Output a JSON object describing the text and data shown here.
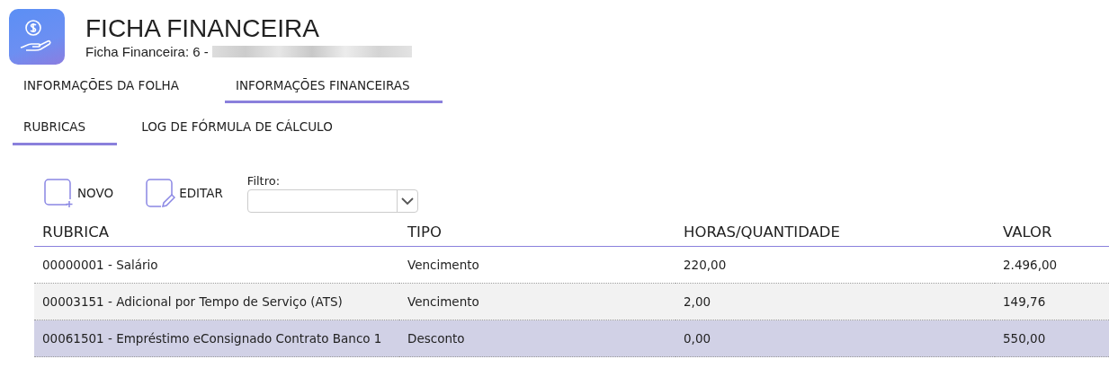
{
  "header": {
    "title": "FICHA FINANCEIRA",
    "subtitle": "Ficha Financeira: 6 -"
  },
  "tabs": [
    {
      "label": "INFORMAÇÕES DA FOLHA",
      "selected": false
    },
    {
      "label": "INFORMAÇÕES FINANCEIRAS",
      "selected": true
    }
  ],
  "subtabs": [
    {
      "label": "RUBRICAS",
      "selected": true
    },
    {
      "label": "LOG DE FÓRMULA DE CÁLCULO",
      "selected": false
    }
  ],
  "toolbar": {
    "buttons": [
      {
        "kind": "new",
        "label": "NOVO"
      },
      {
        "kind": "edit",
        "label": "EDITAR"
      }
    ],
    "filter_label": "Filtro:"
  },
  "table": {
    "columns": [
      "RUBRICA",
      "TIPO",
      "HORAS/QUANTIDADE",
      "VALOR"
    ],
    "rows": [
      {
        "cells": [
          "00000001 - Salário",
          "Vencimento",
          "220,00",
          "2.496,00"
        ],
        "selected": false
      },
      {
        "cells": [
          "00003151 - Adicional por Tempo de Serviço (ATS)",
          "Vencimento",
          "2,00",
          "149,76"
        ],
        "selected": false
      },
      {
        "cells": [
          "00061501 - Empréstimo eConsignado Contrato Banco 1",
          "Desconto",
          "0,00",
          "550,00"
        ],
        "selected": true
      }
    ]
  }
}
